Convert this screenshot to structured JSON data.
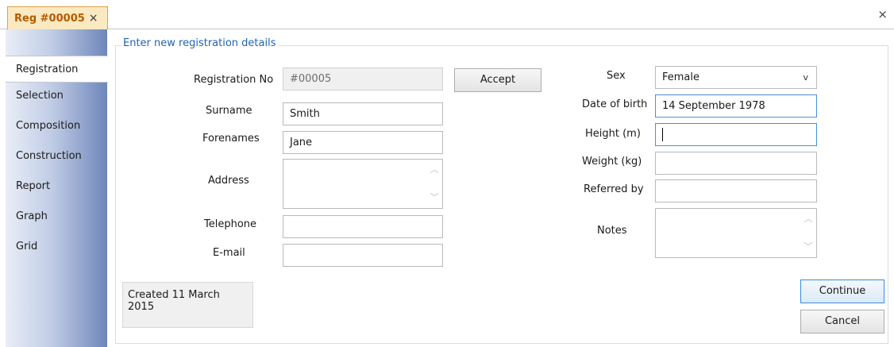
{
  "tab": {
    "title": "Reg #00005",
    "close_glyph": "×"
  },
  "window": {
    "close_glyph": "×"
  },
  "sidebar": {
    "items": [
      {
        "label": "Registration",
        "active": true
      },
      {
        "label": "Selection"
      },
      {
        "label": "Composition"
      },
      {
        "label": "Construction"
      },
      {
        "label": "Report"
      },
      {
        "label": "Graph"
      },
      {
        "label": "Grid"
      }
    ]
  },
  "form": {
    "group_title": "Enter new registration details",
    "registration_no": {
      "label": "Registration No",
      "value": "#00005"
    },
    "accept_label": "Accept",
    "surname": {
      "label": "Surname",
      "value": "Smith"
    },
    "forenames": {
      "label": "Forenames",
      "value": "Jane"
    },
    "address": {
      "label": "Address",
      "value": ""
    },
    "telephone": {
      "label": "Telephone",
      "value": ""
    },
    "email": {
      "label": "E-mail",
      "value": ""
    },
    "sex": {
      "label": "Sex",
      "value": "Female"
    },
    "dob": {
      "label": "Date of birth",
      "value": "14 September 1978"
    },
    "height": {
      "label": "Height (m)",
      "value": ""
    },
    "weight": {
      "label": "Weight (kg)",
      "value": ""
    },
    "referred_by": {
      "label": "Referred by",
      "value": ""
    },
    "notes": {
      "label": "Notes",
      "value": ""
    },
    "created": "Created 11 March 2015",
    "continue_label": "Continue",
    "cancel_label": "Cancel"
  },
  "icons": {
    "scroll_up": "chevron-up-icon",
    "scroll_down": "chevron-down-icon",
    "select_chevron": "chevron-down-icon"
  },
  "colors": {
    "tab_accent": "#b25c00",
    "group_title": "#1e64b4",
    "sidebar_gradient_end": "#6f86bb"
  }
}
